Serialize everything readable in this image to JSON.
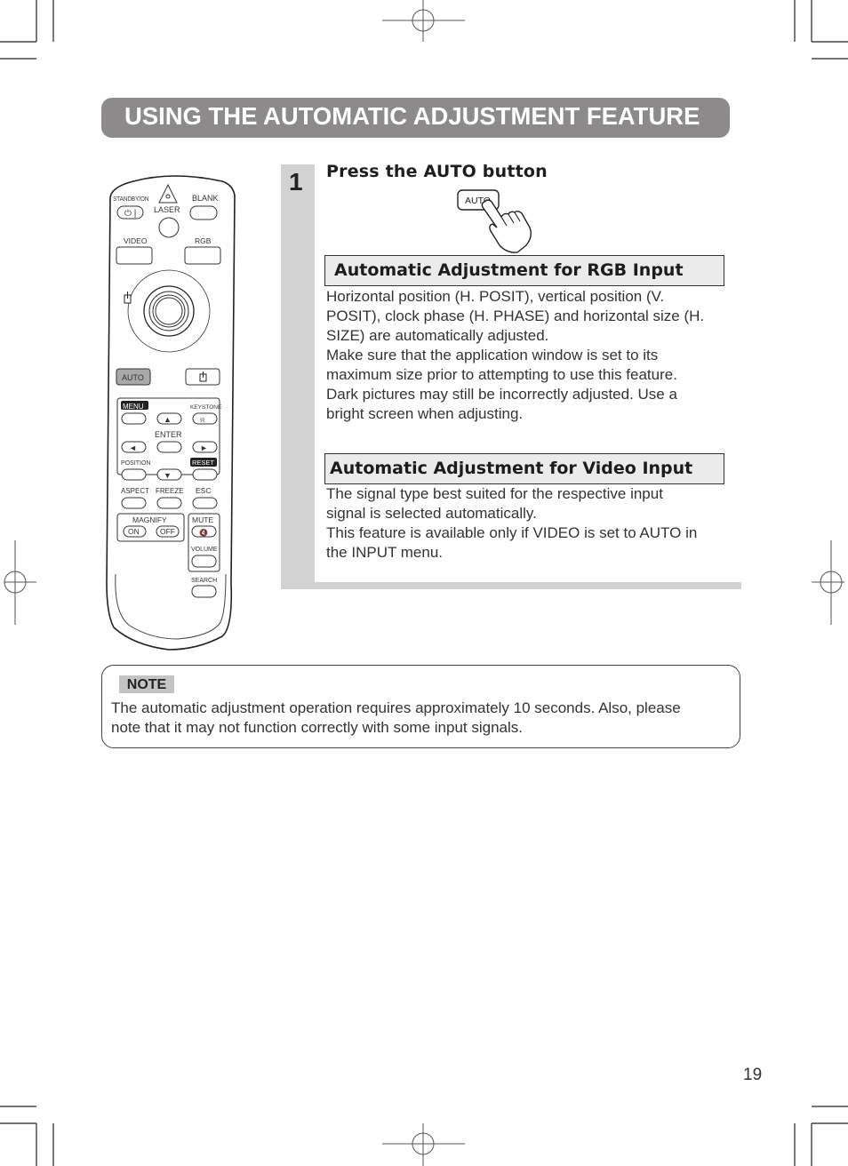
{
  "page": {
    "title": "USING THE AUTOMATIC ADJUSTMENT FEATURE",
    "page_number": "19"
  },
  "step": {
    "number": "1",
    "heading": "Press the AUTO button",
    "illustration_button_label": "AUTO"
  },
  "sections": [
    {
      "heading": "Automatic Adjustment for RGB Input",
      "lines": [
        "Horizontal position (H. POSIT), vertical position (V.",
        "POSIT), clock phase (H. PHASE) and horizontal size (H.",
        "SIZE) are automatically adjusted.",
        "Make sure that the application window is set to its",
        "maximum size prior to attempting to use this feature.",
        "Dark pictures may still be incorrectly adjusted. Use a",
        "bright screen when adjusting."
      ]
    },
    {
      "heading": "Automatic Adjustment for Video Input",
      "lines": [
        "The signal type best suited for the respective input",
        "signal is selected automatically.",
        "This feature is available only if VIDEO is set to AUTO in",
        "the INPUT menu."
      ]
    }
  ],
  "note": {
    "label": "NOTE",
    "lines": [
      "The automatic adjustment operation requires approximately 10 seconds. Also, please",
      "note that it may not function correctly with some input signals."
    ]
  },
  "remote": {
    "standby": "STANDBY/ON",
    "laser": "LASER",
    "blank": "BLANK",
    "video": "VIDEO",
    "rgb": "RGB",
    "auto": "AUTO",
    "menu": "MENU",
    "keystone": "KEYSTONE",
    "enter": "ENTER",
    "position": "POSITION",
    "reset": "RESET",
    "aspect": "ASPECT",
    "freeze": "FREEZE",
    "esc": "ESC",
    "magnify": "MAGNIFY",
    "on": "ON",
    "off": "OFF",
    "mute": "MUTE",
    "volume": "VOLUME",
    "search": "SEARCH",
    "auto_highlight_color": "#a9a9a9"
  }
}
